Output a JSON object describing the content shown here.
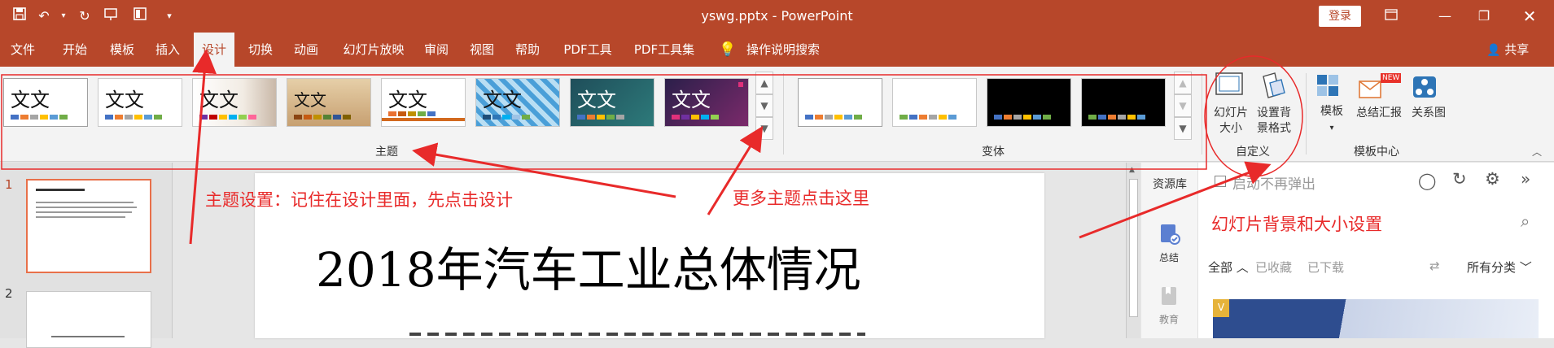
{
  "titlebar": {
    "doc_title": "yswg.pptx  -  PowerPoint",
    "login_label": "登录",
    "quick_access_icons": [
      "save-icon",
      "undo-icon",
      "redo-icon",
      "presentation-icon",
      "layout-icon",
      "customize-icon"
    ],
    "window_controls": [
      "ribbon-display-icon",
      "minimize-icon",
      "restore-icon",
      "close-icon"
    ]
  },
  "tabs": [
    {
      "label": "文件"
    },
    {
      "label": "开始"
    },
    {
      "label": "模板"
    },
    {
      "label": "插入"
    },
    {
      "label": "设计"
    },
    {
      "label": "切换"
    },
    {
      "label": "动画"
    },
    {
      "label": "幻灯片放映"
    },
    {
      "label": "审阅"
    },
    {
      "label": "视图"
    },
    {
      "label": "帮助"
    },
    {
      "label": "PDF工具"
    },
    {
      "label": "PDF工具集"
    },
    {
      "label": "操作说明搜索"
    }
  ],
  "active_tab": "设计",
  "share_label": "共享",
  "ribbon": {
    "themes_group_label": "主题",
    "theme_sample_text": "文文",
    "variants_group_label": "变体",
    "customize_group_label": "自定义",
    "slide_size_label": "幻灯片大小",
    "slide_size_caret": "⌄",
    "format_bg_label_1": "设置背",
    "format_bg_label_2": "景格式",
    "slide_size_line1": "幻灯片",
    "slide_size_line2": "大小",
    "template_center_label": "模板中心",
    "template_label": "模板",
    "summary_label": "总结汇报",
    "relation_label": "关系图",
    "new_badge": "NEW"
  },
  "slides_panel": {
    "slide1_num": "1",
    "slide2_num": "2"
  },
  "slide": {
    "title": "2018年汽车工业总体情况"
  },
  "resource_panel": {
    "side_title": "资源库",
    "side_item_summary": "总结",
    "side_item_edu": "教育",
    "checkbox_label": "启动不再弹出",
    "heading": "幻灯片背景和大小设置",
    "filter_all": "全部",
    "filter_fav": "已收藏",
    "filter_dl": "已下载",
    "category": "所有分类"
  },
  "annotations": {
    "note_design": "主题设置：记住在设计里面，先点击设计",
    "note_more": "更多主题点击这里"
  },
  "colors": {
    "accent": "#b7472a",
    "annotation": "#e82a2a"
  }
}
